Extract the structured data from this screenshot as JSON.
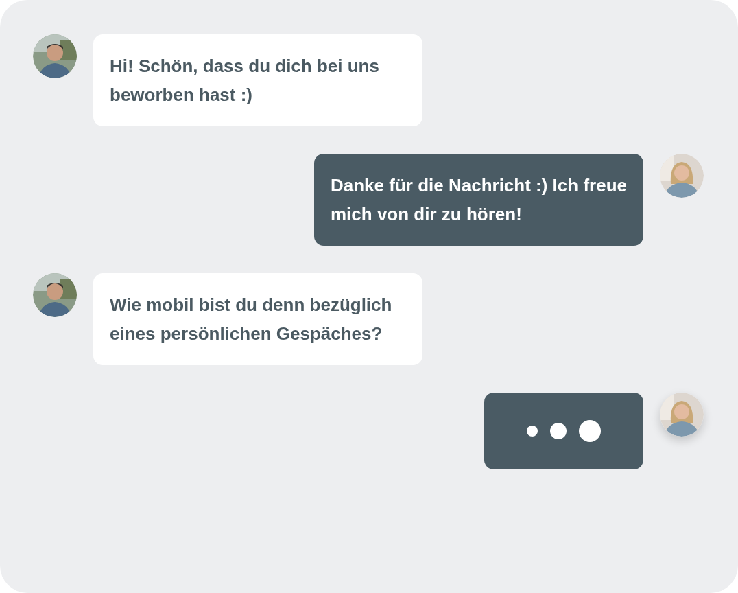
{
  "messages": [
    {
      "kind": "received",
      "text": "Hi! Schön, dass du dich bei uns beworben hast :)"
    },
    {
      "kind": "sent",
      "text": "Danke für die Nachricht :) Ich freue mich von dir zu hören!"
    },
    {
      "kind": "received",
      "text": "Wie mobil bist du denn bezüglich eines persönlichen Gespäches?"
    },
    {
      "kind": "typing"
    }
  ]
}
